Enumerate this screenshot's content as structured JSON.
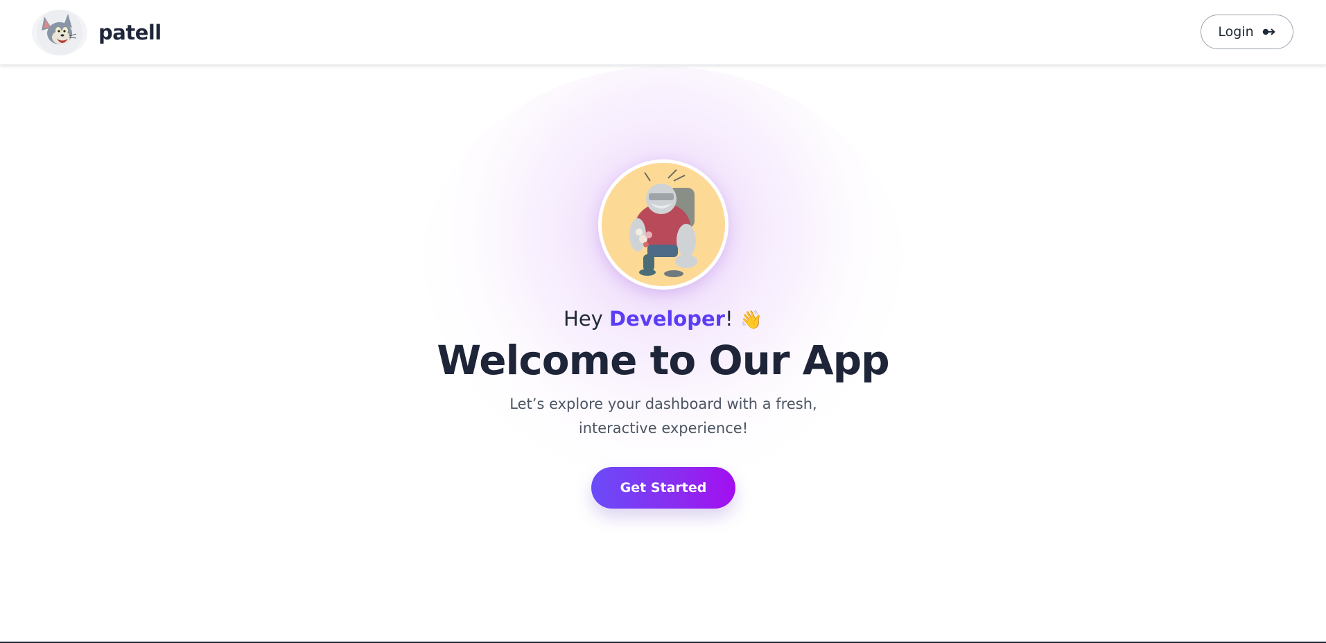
{
  "header": {
    "brand_name": "patell",
    "logo_icon": "cat-mascot-logo",
    "login_label": "Login",
    "login_icon": "sign-in-icon"
  },
  "hero": {
    "avatar_icon": "character-avatar",
    "greeting_prefix": "Hey ",
    "greeting_name": "Developer",
    "greeting_suffix": "!",
    "greeting_emoji": "👋",
    "title": "Welcome to Our App",
    "subtitle": "Let’s explore your dashboard with a fresh, interactive experience!",
    "cta_label": "Get Started"
  },
  "colors": {
    "accent": "#5b3df5",
    "cta_gradient_start": "#6a4cf8",
    "cta_gradient_end": "#a30ff0",
    "heading": "#1e2538",
    "body_text": "#4b5563"
  }
}
